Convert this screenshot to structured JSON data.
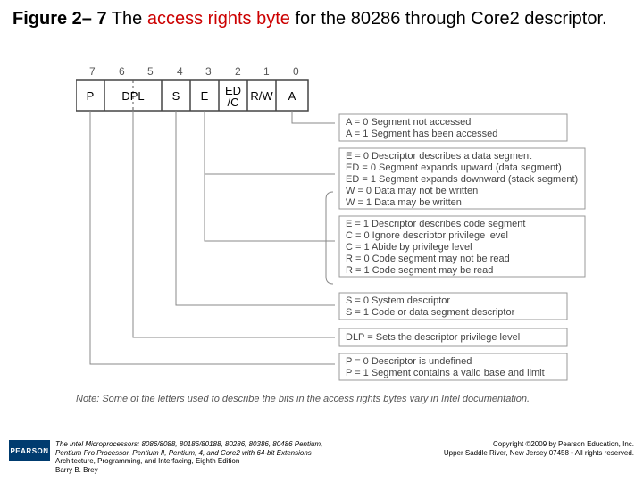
{
  "caption": {
    "fig": "Figure 2– 7",
    "part1": "  The ",
    "red": "access rights byte",
    "part2": " for the 80286 through Core2 descriptor."
  },
  "bits": [
    "7",
    "6",
    "5",
    "4",
    "3",
    "2",
    "1",
    "0"
  ],
  "cells": [
    "P",
    "DPL",
    "S",
    "E",
    "ED\n/C",
    "R/W",
    "A"
  ],
  "anns": {
    "a": [
      "A = 0   Segment not accessed",
      "A = 1   Segment has been accessed"
    ],
    "data": [
      "E  = 0    Descriptor describes a data segment",
      "ED = 0   Segment expands upward (data segment)",
      "ED = 1   Segment expands downward (stack segment)",
      "W = 0    Data may not be written",
      "W = 1    Data may be written"
    ],
    "code": [
      "E = 1   Descriptor describes code segment",
      "C = 0   Ignore descriptor privilege level",
      "C = 1   Abide by privilege level",
      "R = 0   Code segment may not be read",
      "R = 1   Code segment may be read"
    ],
    "s": [
      "S = 0   System descriptor",
      "S = 1   Code or data segment descriptor"
    ],
    "dlp": [
      "DLP =  Sets the descriptor privilege level"
    ],
    "p": [
      "P = 0   Descriptor is undefined",
      "P = 1   Segment contains a valid base and limit"
    ]
  },
  "note": "Note:  Some of the letters used to describe the bits in the access rights bytes vary in Intel documentation.",
  "footer": {
    "pearson": "PEARSON",
    "book1": "The Intel Microprocessors: 8086/8088, 80186/80188, 80286, 80386, 80486 Pentium,",
    "book2": "Pentium Pro Processor, Pentium II, Pentium, 4, and Core2 with 64-bit Extensions",
    "book3": "Architecture, Programming, and Interfacing, Eighth Edition",
    "author": "Barry B. Brey",
    "copy1": "Copyright ©2009 by Pearson Education, Inc.",
    "copy2": "Upper Saddle River, New Jersey 07458 • All rights reserved."
  }
}
